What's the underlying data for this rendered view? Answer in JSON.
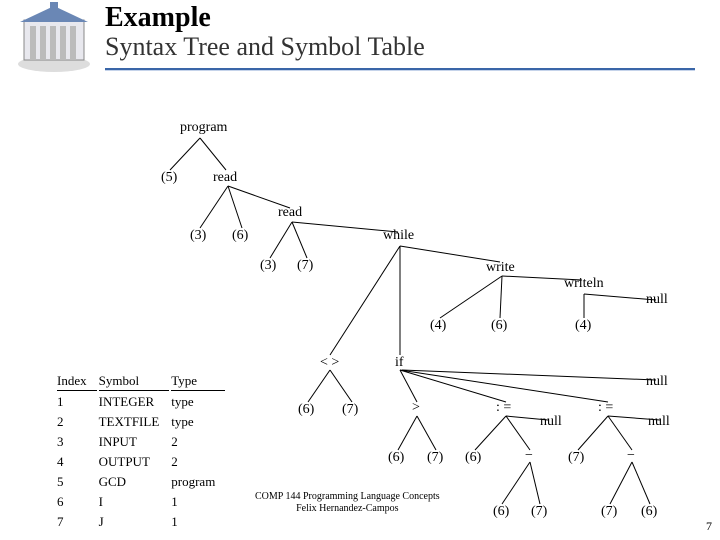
{
  "header": {
    "title": "Example",
    "subtitle": "Syntax Tree and Symbol Table"
  },
  "tree": {
    "program": "program",
    "n5": "(5)",
    "read1": "read",
    "n3a": "(3)",
    "n6a": "(6)",
    "read2": "read",
    "while": "while",
    "n3b": "(3)",
    "n7a": "(7)",
    "write": "write",
    "writeln": "writeln",
    "n4a": "(4)",
    "n6b": "(6)",
    "n4b": "(4)",
    "null1": "null",
    "neq": "< >",
    "if": "if",
    "n6c": "(6)",
    "n7b": "(7)",
    "null2": "null",
    "gt": ">",
    "asg1": ": =",
    "asg2": ": =",
    "null3": "null",
    "null4": "null",
    "n6d": "(6)",
    "n7c": "(7)",
    "n6e": "(6)",
    "minus1": "−",
    "n7d": "(7)",
    "minus2": "−",
    "n6f": "(6)",
    "n7e": "(7)",
    "n7f": "(7)",
    "n6g": "(6)"
  },
  "symbol_table": {
    "headers": [
      "Index",
      "Symbol",
      "Type"
    ],
    "rows": [
      [
        "1",
        "INTEGER",
        "type"
      ],
      [
        "2",
        "TEXTFILE",
        "type"
      ],
      [
        "3",
        "INPUT",
        "2"
      ],
      [
        "4",
        "OUTPUT",
        "2"
      ],
      [
        "5",
        "GCD",
        "program"
      ],
      [
        "6",
        "I",
        "1"
      ],
      [
        "7",
        "J",
        "1"
      ]
    ]
  },
  "footer": {
    "line1": "COMP 144 Programming Language Concepts",
    "line2": "Felix Hernandez-Campos"
  },
  "page_number": "7"
}
